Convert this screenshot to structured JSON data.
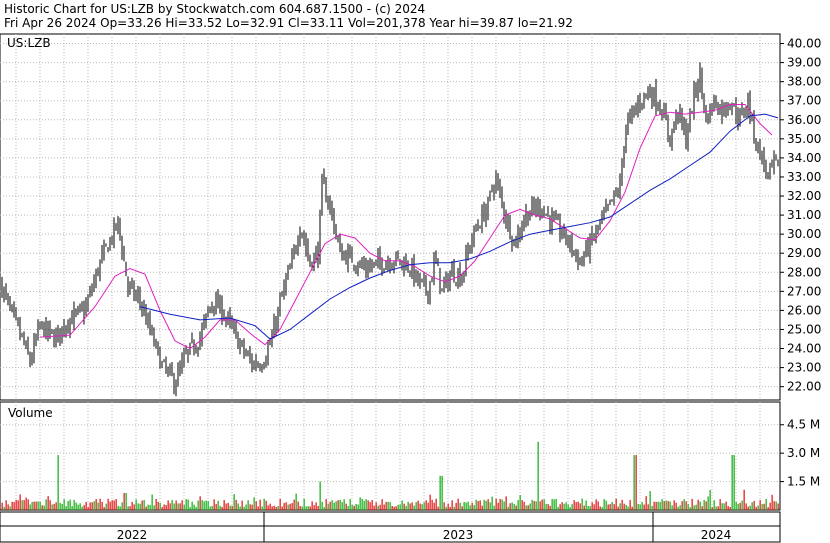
{
  "header": {
    "line1": "Historic Chart for US:LZB by Stockwatch.com 604.687.1500 - (c) 2024",
    "line2": "Fri Apr 26 2024   Op=33.26   Hi=33.52   Lo=32.91   Cl=33.11   Vol=201,378   Year hi=39.87   lo=21.92"
  },
  "chart_data": {
    "type": "bar",
    "title": "US:LZB",
    "price_ylim": [
      21.3,
      40.5
    ],
    "price_ticks": [
      "22.00",
      "23.00",
      "24.00",
      "25.00",
      "26.00",
      "27.00",
      "28.00",
      "29.00",
      "30.00",
      "31.00",
      "32.00",
      "33.00",
      "34.00",
      "35.00",
      "36.00",
      "37.00",
      "38.00",
      "39.00",
      "40.00"
    ],
    "volume_title": "Volume",
    "volume_ticks": [
      "1.5 M",
      "3.0 M",
      "4.5 M"
    ],
    "volume_ylim": [
      0,
      5.7
    ],
    "x_labels": [
      "2022",
      "2023",
      "2024"
    ],
    "grid": true,
    "colors": {
      "price_bar": "#000000",
      "ma_short": "#e020c0",
      "ma_long": "#1020c0",
      "vol_up": "#20b020",
      "vol_down": "#e02020",
      "grid": "#b8b8b8",
      "background": "#ffffff"
    },
    "price_anchors": [
      [
        0,
        27.5
      ],
      [
        10,
        26.0
      ],
      [
        22,
        24.5
      ],
      [
        30,
        23.3
      ],
      [
        40,
        25.2
      ],
      [
        55,
        24.5
      ],
      [
        68,
        25.5
      ],
      [
        85,
        26.0
      ],
      [
        100,
        28.5
      ],
      [
        118,
        30.6
      ],
      [
        128,
        27.2
      ],
      [
        140,
        26.5
      ],
      [
        152,
        24.6
      ],
      [
        162,
        23.1
      ],
      [
        175,
        22.2
      ],
      [
        185,
        23.5
      ],
      [
        200,
        24.6
      ],
      [
        212,
        26.5
      ],
      [
        222,
        26.0
      ],
      [
        232,
        25.0
      ],
      [
        242,
        24.0
      ],
      [
        252,
        23.2
      ],
      [
        262,
        23.3
      ],
      [
        272,
        24.5
      ],
      [
        282,
        26.8
      ],
      [
        292,
        28.5
      ],
      [
        300,
        30.5
      ],
      [
        310,
        28.5
      ],
      [
        318,
        29.0
      ],
      [
        322,
        32.6
      ],
      [
        330,
        31.5
      ],
      [
        340,
        29.0
      ],
      [
        352,
        28.7
      ],
      [
        365,
        28.2
      ],
      [
        380,
        28.5
      ],
      [
        395,
        28.7
      ],
      [
        410,
        28.3
      ],
      [
        418,
        27.5
      ],
      [
        428,
        27.0
      ],
      [
        435,
        28.7
      ],
      [
        442,
        27.0
      ],
      [
        452,
        28.0
      ],
      [
        462,
        27.8
      ],
      [
        470,
        29.5
      ],
      [
        478,
        30.5
      ],
      [
        488,
        31.5
      ],
      [
        495,
        33.0
      ],
      [
        505,
        31.0
      ],
      [
        515,
        29.5
      ],
      [
        525,
        31.0
      ],
      [
        540,
        31.5
      ],
      [
        550,
        30.8
      ],
      [
        560,
        30.2
      ],
      [
        570,
        29.5
      ],
      [
        580,
        28.5
      ],
      [
        590,
        29.5
      ],
      [
        600,
        30.5
      ],
      [
        610,
        31.5
      ],
      [
        620,
        32.5
      ],
      [
        625,
        35.5
      ],
      [
        632,
        36.2
      ],
      [
        640,
        37.0
      ],
      [
        648,
        37.5
      ],
      [
        655,
        37.2
      ],
      [
        662,
        36.5
      ],
      [
        670,
        35.0
      ],
      [
        678,
        36.5
      ],
      [
        686,
        35.0
      ],
      [
        695,
        37.5
      ],
      [
        700,
        38.3
      ],
      [
        706,
        36.0
      ],
      [
        714,
        37.0
      ],
      [
        722,
        36.5
      ],
      [
        730,
        37.0
      ],
      [
        740,
        36.0
      ],
      [
        748,
        37.0
      ],
      [
        755,
        35.0
      ],
      [
        762,
        34.0
      ],
      [
        768,
        33.0
      ],
      [
        775,
        33.8
      ],
      [
        780,
        33.1
      ]
    ],
    "ma_short_anchors": [
      [
        40,
        24.6
      ],
      [
        70,
        24.7
      ],
      [
        95,
        26.2
      ],
      [
        115,
        27.8
      ],
      [
        130,
        28.2
      ],
      [
        145,
        27.9
      ],
      [
        160,
        26.0
      ],
      [
        175,
        24.4
      ],
      [
        190,
        24.0
      ],
      [
        205,
        24.6
      ],
      [
        220,
        25.5
      ],
      [
        235,
        25.5
      ],
      [
        250,
        24.8
      ],
      [
        265,
        24.2
      ],
      [
        280,
        25.0
      ],
      [
        295,
        26.5
      ],
      [
        310,
        28.0
      ],
      [
        325,
        29.5
      ],
      [
        340,
        30.0
      ],
      [
        355,
        29.8
      ],
      [
        370,
        29.0
      ],
      [
        385,
        28.6
      ],
      [
        400,
        28.6
      ],
      [
        415,
        28.3
      ],
      [
        430,
        27.8
      ],
      [
        445,
        27.5
      ],
      [
        460,
        27.8
      ],
      [
        475,
        28.6
      ],
      [
        490,
        29.8
      ],
      [
        505,
        31.0
      ],
      [
        520,
        31.3
      ],
      [
        535,
        31.0
      ],
      [
        550,
        30.8
      ],
      [
        565,
        30.3
      ],
      [
        580,
        29.8
      ],
      [
        595,
        29.7
      ],
      [
        610,
        30.7
      ],
      [
        625,
        32.2
      ],
      [
        640,
        34.5
      ],
      [
        655,
        36.2
      ],
      [
        670,
        36.4
      ],
      [
        685,
        36.3
      ],
      [
        700,
        36.4
      ],
      [
        715,
        36.5
      ],
      [
        730,
        36.8
      ],
      [
        745,
        36.8
      ],
      [
        760,
        35.8
      ],
      [
        772,
        35.2
      ]
    ],
    "ma_long_anchors": [
      [
        140,
        26.2
      ],
      [
        170,
        25.8
      ],
      [
        200,
        25.5
      ],
      [
        230,
        25.6
      ],
      [
        255,
        25.2
      ],
      [
        270,
        24.5
      ],
      [
        290,
        25.0
      ],
      [
        310,
        25.8
      ],
      [
        330,
        26.6
      ],
      [
        350,
        27.2
      ],
      [
        370,
        27.7
      ],
      [
        390,
        28.1
      ],
      [
        410,
        28.4
      ],
      [
        430,
        28.5
      ],
      [
        450,
        28.5
      ],
      [
        470,
        28.7
      ],
      [
        490,
        29.1
      ],
      [
        510,
        29.6
      ],
      [
        530,
        30.0
      ],
      [
        550,
        30.2
      ],
      [
        570,
        30.4
      ],
      [
        590,
        30.6
      ],
      [
        610,
        30.9
      ],
      [
        630,
        31.6
      ],
      [
        650,
        32.3
      ],
      [
        670,
        32.9
      ],
      [
        690,
        33.6
      ],
      [
        710,
        34.3
      ],
      [
        730,
        35.4
      ],
      [
        750,
        36.2
      ],
      [
        765,
        36.3
      ],
      [
        778,
        36.1
      ]
    ],
    "volume_spikes": [
      [
        58,
        2.9
      ],
      [
        125,
        0.9
      ],
      [
        320,
        1.5
      ],
      [
        441,
        1.8
      ],
      [
        538,
        3.6
      ],
      [
        635,
        2.9
      ],
      [
        650,
        1.0
      ],
      [
        733,
        2.9
      ]
    ]
  }
}
